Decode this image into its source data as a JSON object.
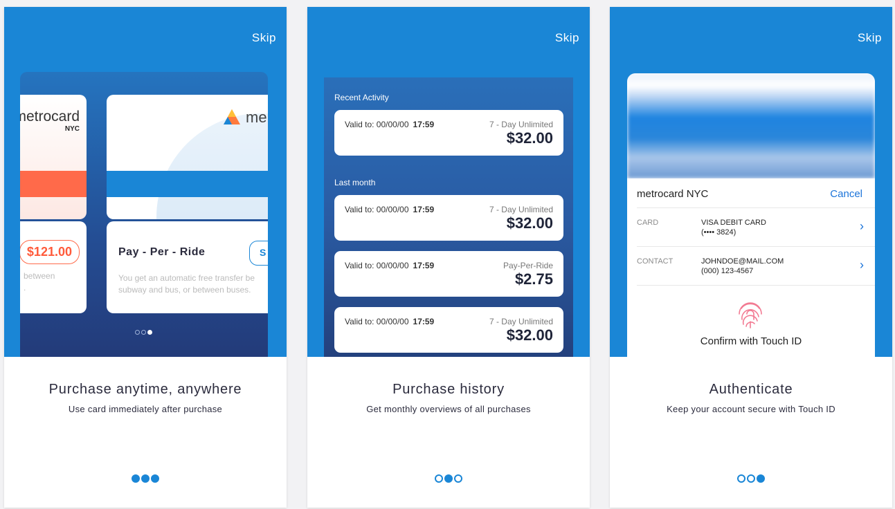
{
  "skip_label": "Skip",
  "panels": [
    {
      "title": "Purchase anytime, anywhere",
      "subtitle": "Use card immediately after purchase",
      "active_dot": 0
    },
    {
      "title": "Purchase history",
      "subtitle": "Get monthly overviews of all purchases",
      "active_dot": 1
    },
    {
      "title": "Authenticate",
      "subtitle": "Keep your account secure with Touch ID",
      "active_dot": 2
    }
  ],
  "panel1": {
    "left_card": {
      "brand": "metrocard",
      "brand_sub": "NYC",
      "price": "$121.00",
      "desc_fragment_1": "between",
      "desc_fragment_2": "."
    },
    "right_card": {
      "brand": "me",
      "title": "Pay - Per - Ride",
      "button_fragment": "S",
      "desc_line1": "You get an automatic free transfer be",
      "desc_line2": "subway and bus, or between buses."
    }
  },
  "panel2": {
    "recent_label": "Recent Activity",
    "last_month_label": "Last month",
    "valid_prefix": "Valid to: 00/00/00",
    "rows": [
      {
        "time": "17:59",
        "type": "7 - Day Unlimited",
        "amount": "$32.00"
      },
      {
        "time": "17:59",
        "type": "7 - Day Unlimited",
        "amount": "$32.00"
      },
      {
        "time": "17:59",
        "type": "Pay-Per-Ride",
        "amount": "$2.75"
      },
      {
        "time": "17:59",
        "type": "7 - Day Unlimited",
        "amount": "$32.00"
      }
    ]
  },
  "panel3": {
    "merchant": "metrocard NYC",
    "cancel": "Cancel",
    "card_label": "CARD",
    "card_line1": "VISA DEBIT CARD",
    "card_line2": "(•••• 3824)",
    "contact_label": "CONTACT",
    "contact_line1": "JOHNDOE@MAIL.COM",
    "contact_line2": "(000) 123-4567",
    "touch_label": "Confirm with Touch ID"
  },
  "colors": {
    "primary": "#1a86d6",
    "accent": "#ff6a4a",
    "link": "#1a73d9",
    "fingerprint": "#f27a92"
  }
}
